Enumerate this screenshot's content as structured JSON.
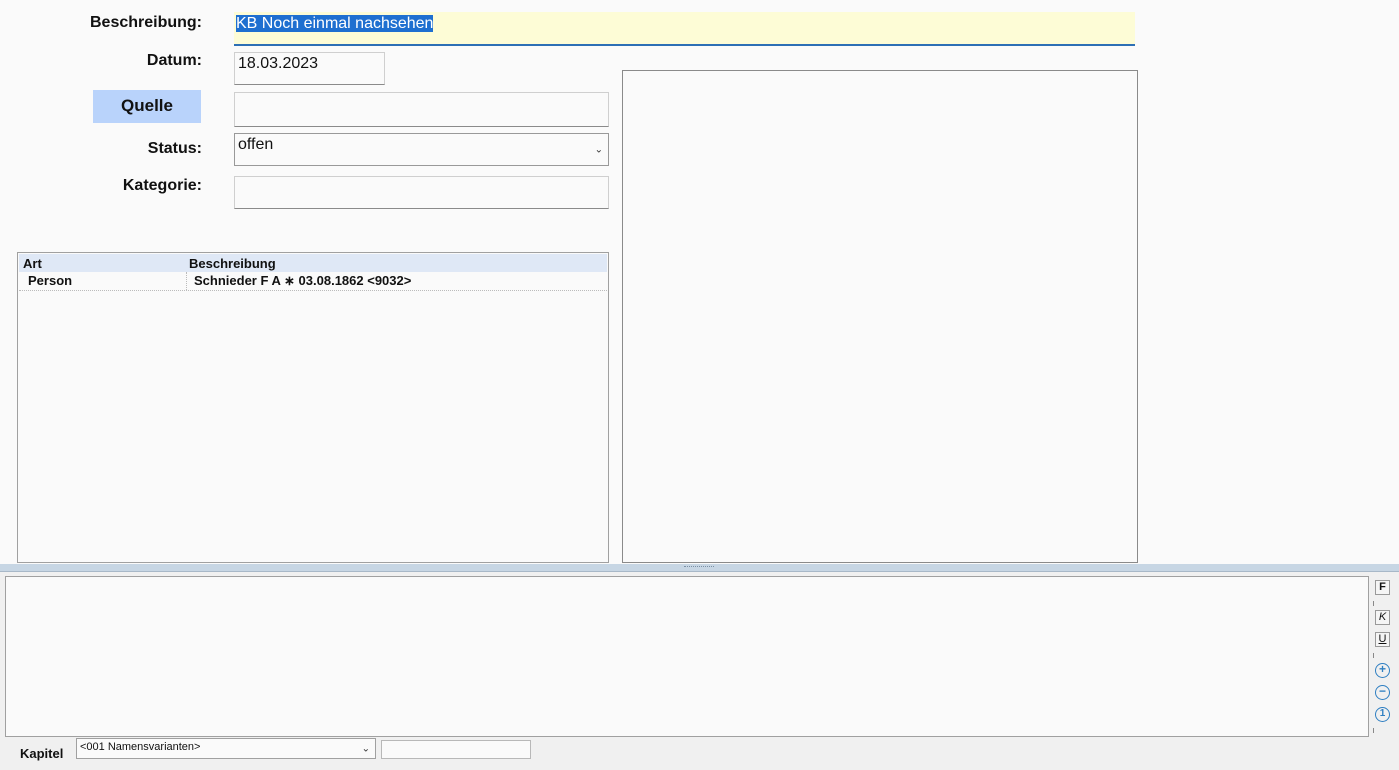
{
  "form": {
    "beschreibung_label": "Beschreibung:",
    "beschreibung_value": "KB Noch einmal nachsehen",
    "datum_label": "Datum:",
    "datum_value": "18.03.2023",
    "quelle_button": "Quelle",
    "quelle_value": "",
    "status_label": "Status:",
    "status_value": "offen",
    "kategorie_label": "Kategorie:",
    "kategorie_value": ""
  },
  "grid": {
    "columns": [
      "Art",
      "Beschreibung"
    ],
    "rows": [
      {
        "art": "Person",
        "beschreibung": "Schnieder F A ∗ 03.08.1862 <9032>"
      }
    ]
  },
  "toolbar": {
    "bold": "F",
    "italic": "K",
    "underline": "U",
    "plus": "+",
    "minus": "−",
    "one": "1"
  },
  "bottom": {
    "kapitel_label": "Kapitel",
    "kapitel_value": "<001 Namensvarianten>",
    "extra_value": ""
  }
}
